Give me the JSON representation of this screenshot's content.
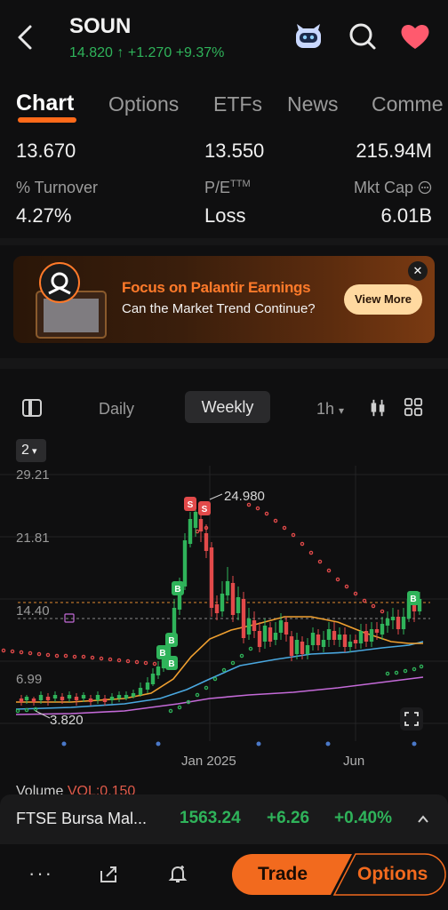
{
  "header": {
    "ticker": "SOUN",
    "price": "14.820",
    "arrow": "↑",
    "change": "+1.270",
    "change_pct": "+9.37%",
    "up_color": "#2fb35a",
    "icons": [
      "back-arrow-icon",
      "robot-assistant-icon",
      "search-icon",
      "heart-icon"
    ]
  },
  "tabs": [
    "Chart",
    "Options",
    "ETFs",
    "News",
    "Comme"
  ],
  "stats": {
    "row1": [
      "13.670",
      "13.550",
      "215.94M"
    ],
    "row2_labels": [
      "% Turnover",
      "P/E",
      "TTM",
      "Mkt Cap"
    ],
    "row2_values": [
      "4.27%",
      "Loss",
      "6.01B"
    ]
  },
  "banner": {
    "title": "Focus on Palantir Earnings",
    "subtitle": "Can the Market Trend Continue?",
    "button": "View More",
    "close": "✕"
  },
  "chart_toolbar": {
    "periods": [
      "Daily",
      "Weekly",
      "1h"
    ],
    "active": "Weekly",
    "level": "2"
  },
  "chart_data": {
    "type": "line",
    "y_ticks": [
      "29.21",
      "21.81",
      "14.40",
      "6.99"
    ],
    "x_ticks": [
      "Jan 2025",
      "Jun"
    ],
    "high_label": "24.980",
    "low_label": "3.820",
    "markers": [
      "S",
      "S",
      "B",
      "B",
      "B",
      "B",
      "B"
    ],
    "colors": {
      "up": "#2fb35a",
      "down": "#e24a4a",
      "ma1": "#f0a030",
      "ma2": "#4aa8e0",
      "ma3": "#c46ad8",
      "sar_down": "#e24a4a",
      "sar_up": "#2fb35a"
    }
  },
  "volume_label": {
    "name": "Volume",
    "value": "VOL:0.150"
  },
  "bottom_ticker": {
    "name": "FTSE Bursa Mal...",
    "price": "1563.24",
    "change": "+6.26",
    "pct": "+0.40%"
  },
  "bottom_bar": {
    "trade": "Trade",
    "options": "Options",
    "icons": [
      "more-icon",
      "share-icon",
      "alert-bell-icon"
    ]
  }
}
